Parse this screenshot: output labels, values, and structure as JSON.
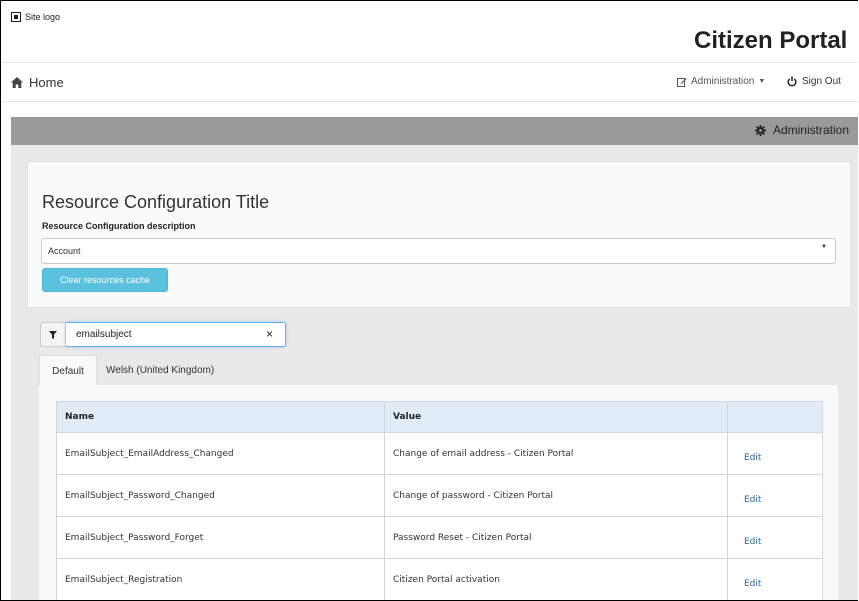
{
  "header": {
    "logo_alt": "Site logo",
    "portal_title": "Citizen Portal"
  },
  "navbar": {
    "home_label": "Home",
    "admin_menu_label": "Administration",
    "signout_label": "Sign Out"
  },
  "admin_bar": {
    "label": "Administration"
  },
  "config": {
    "title": "Resource Configuration Title",
    "description": "Resource Configuration description",
    "selected_resource": "Account",
    "clear_cache_label": "Clear resources cache"
  },
  "filter": {
    "value": "emailsubject",
    "clear_symbol": "×"
  },
  "tabs": [
    {
      "label": "Default"
    },
    {
      "label": "Welsh (United Kingdom)"
    }
  ],
  "table": {
    "headers": {
      "name": "Name",
      "value": "Value",
      "action": ""
    },
    "rows": [
      {
        "name": "EmailSubject_EmailAddress_Changed",
        "value": "Change of email address - Citizen Portal",
        "action": "Edit"
      },
      {
        "name": "EmailSubject_Password_Changed",
        "value": "Change of password - Citizen Portal",
        "action": "Edit"
      },
      {
        "name": "EmailSubject_Password_Forget",
        "value": "Password Reset - Citizen Portal",
        "action": "Edit"
      },
      {
        "name": "EmailSubject_Registration",
        "value": "Citizen Portal activation",
        "action": "Edit"
      }
    ]
  },
  "icons": {
    "logo": "image-icon",
    "home": "home-icon",
    "admin_menu": "edit-icon",
    "signout": "power-icon",
    "admin_bar": "gear-icon",
    "filter": "filter-icon"
  },
  "colors": {
    "admin_bar": "#9a9a9a",
    "content_bg": "#e9e9e9",
    "button_info": "#5bc0de",
    "table_header": "#e2ecf7",
    "link": "#2a6496"
  }
}
